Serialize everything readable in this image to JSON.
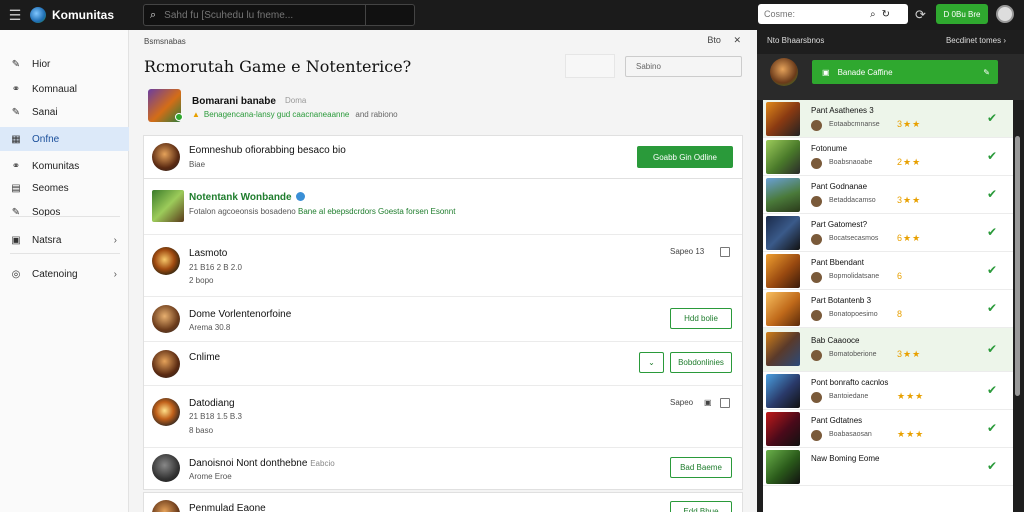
{
  "app": {
    "title": "Komunitas"
  },
  "search": {
    "placeholder": "Sahd fu [Scuhedu lu fneme..."
  },
  "right_search": {
    "placeholder": "Cosme:"
  },
  "top_button": {
    "label": "D 0Bu Bre"
  },
  "nav": {
    "items": [
      {
        "label": "Hior",
        "icon": "pencil-icon"
      },
      {
        "label": "Komnaual",
        "icon": "community-icon"
      },
      {
        "label": "Sanai",
        "icon": "pencil-icon"
      },
      {
        "label": "Onfne",
        "icon": "grid-icon",
        "active": true
      },
      {
        "label": "Komunitas",
        "icon": "community-icon"
      },
      {
        "label": "Seomes",
        "icon": "list-icon"
      },
      {
        "label": "Sopos",
        "icon": "pencil-icon"
      },
      {
        "label": "Natsra",
        "icon": "box-icon"
      },
      {
        "label": "Catenoing",
        "icon": "globe-icon"
      }
    ]
  },
  "main": {
    "breadcrumb": "Bsmsnabas",
    "crumb_actions": [
      "Bto",
      "✕"
    ],
    "heading": "Rcmorutah Game e Notenterice?",
    "header_button": "Sabino",
    "game": {
      "name": "Bomarani banabe",
      "name_sub": "Doma",
      "warning": "Benagencana-lansy gud caacnaneaanne",
      "warning_extra": "and rabiono"
    },
    "rows": [
      {
        "title": "Eomneshub ofiorabbing besaco bio",
        "sub": "Biae",
        "button": "Goabb Gin Odline"
      },
      {
        "title": "Notentank Wonbande",
        "sub": "Fotalon agcoeonsis bosadeno",
        "link": "Bane al ebepsdcrdors Goesta forsen Esonnt"
      },
      {
        "title": "Lasmoto",
        "sub": "21 B16 2 B 2.0",
        "sub2": "2 bopo",
        "meta": "Sapeo 13"
      },
      {
        "title": "Dome Vorlentenorfoine",
        "sub": "Arema 30.8",
        "button": "Hdd bolie"
      },
      {
        "title": "Cnlime",
        "button": "Bobdonlinies",
        "chevron": "⌄"
      },
      {
        "title": "Datodiang",
        "sub": "21 B18 1.5 B.3",
        "sub2": "8 baso",
        "meta": "Sapeo"
      },
      {
        "title": "Danoisnoi Nont donthebne",
        "title_sub": "Eabcio",
        "sub": "Arome Eroe",
        "button": "Bad Baeme"
      },
      {
        "title": "Penmulad Eaone",
        "button": "Edd Bhue"
      }
    ]
  },
  "right_panel": {
    "header": "Nto Bhaarsbnos",
    "header_right": "Becdinet tomes",
    "hero_button": "Banade Caffine",
    "items": [
      {
        "title": "Pant Asathenes 3",
        "meta": "Eotaabcmnanse",
        "stars": "3★★"
      },
      {
        "title": "Fotonume",
        "meta": "Boabsnaoabe",
        "stars": "2★★"
      },
      {
        "title": "Pant Godnanae",
        "meta": "Betaddacamso",
        "stars": "3★★"
      },
      {
        "title": "Part Gatomest?",
        "meta": "Bocatsecasmos",
        "stars": "6★★"
      },
      {
        "title": "Pant Bbendant",
        "meta": "Bopmolidatsane",
        "stars": "6"
      },
      {
        "title": "Part Botantenb 3",
        "meta": "Bonatopoesimo",
        "stars": "8"
      },
      {
        "title": "Bab Caaooce",
        "meta": "Bomatoberione",
        "stars": "3★★",
        "selected": true
      },
      {
        "title": "Pont bonrafto cacnlos",
        "meta": "Bantoiedane",
        "stars": "★★★"
      },
      {
        "title": "Pant Gdtatnes",
        "meta": "Boabasaosan",
        "stars": "★★★"
      },
      {
        "title": "Naw Boming Eome",
        "meta": "",
        "stars": ""
      }
    ]
  },
  "colors": {
    "accent_green": "#2fa82f",
    "nav_active_bg": "#dce9f9",
    "topbar": "#1b1b1b"
  }
}
